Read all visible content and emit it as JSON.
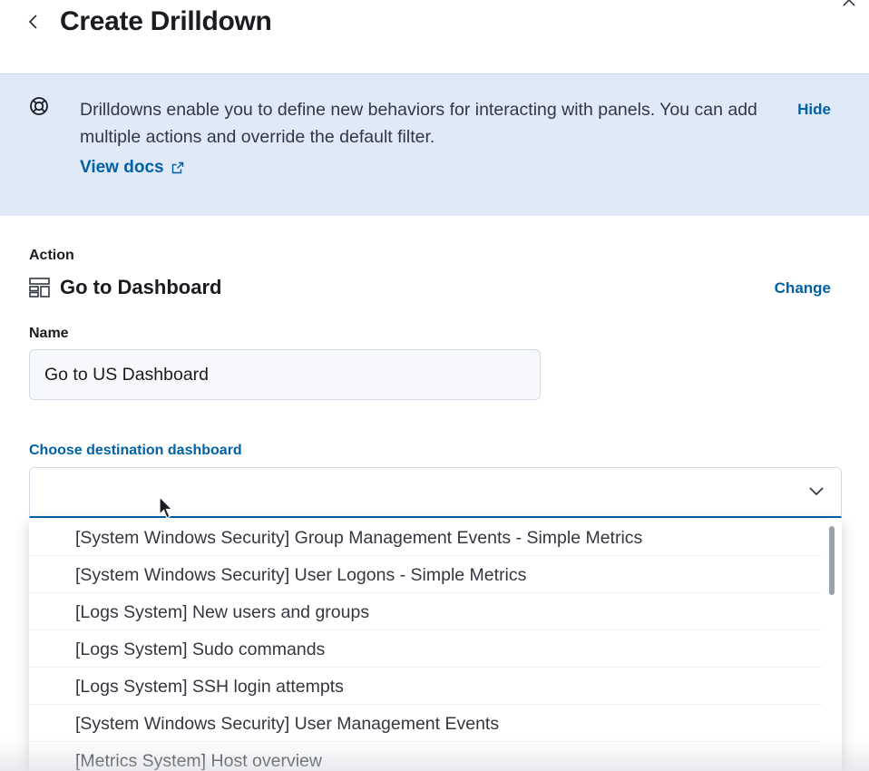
{
  "header": {
    "title": "Create Drilldown"
  },
  "callout": {
    "text": "Drilldowns enable you to define new behaviors for interacting with panels. You can add multiple actions and override the default filter.",
    "hide_label": "Hide",
    "docs_label": "View docs"
  },
  "action": {
    "label": "Action",
    "name": "Go to Dashboard",
    "change_label": "Change"
  },
  "name_field": {
    "label": "Name",
    "value": "Go to US Dashboard"
  },
  "destination": {
    "label": "Choose destination dashboard",
    "value": "",
    "options": [
      "[System Windows Security] Group Management Events - Simple Metrics",
      "[System Windows Security] User Logons - Simple Metrics",
      "[Logs System] New users and groups",
      "[Logs System] Sudo commands",
      "[Logs System] SSH login attempts",
      "[System Windows Security] User Management Events",
      "[Metrics System] Host overview"
    ]
  },
  "colors": {
    "link": "#0061a6",
    "callout_bg": "#dfe9f8",
    "text": "#1a1c21"
  }
}
